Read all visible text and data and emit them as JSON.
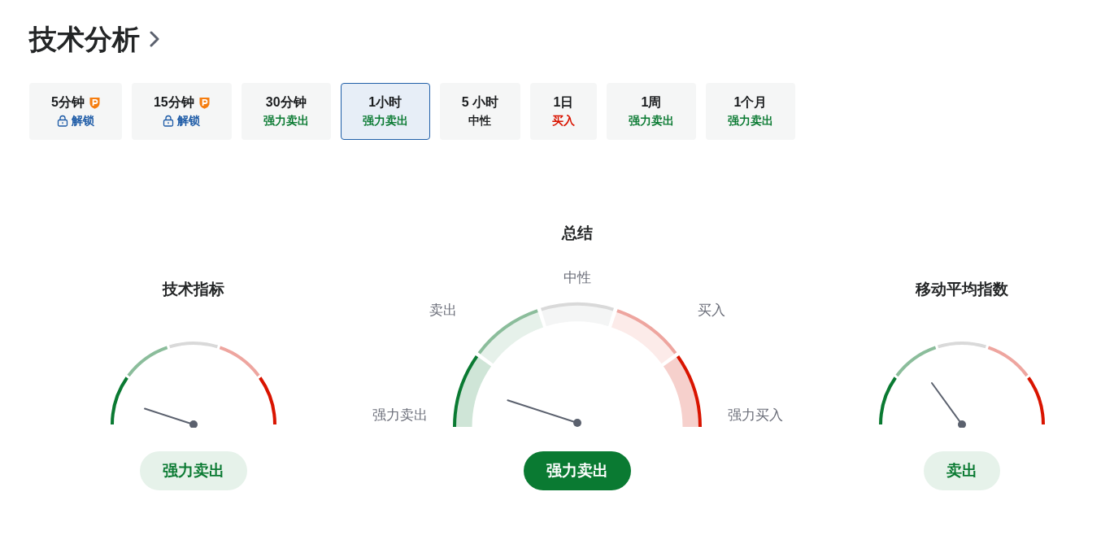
{
  "header": {
    "title": "技术分析"
  },
  "timeframes": [
    {
      "label": "5分钟",
      "status": "解锁",
      "kind": "locked",
      "selected": false
    },
    {
      "label": "15分钟",
      "status": "解锁",
      "kind": "locked",
      "selected": false
    },
    {
      "label": "30分钟",
      "status": "强力卖出",
      "kind": "sell",
      "selected": false
    },
    {
      "label": "1小时",
      "status": "强力卖出",
      "kind": "sell",
      "selected": true
    },
    {
      "label": "5 小时",
      "status": "中性",
      "kind": "neutral",
      "selected": false
    },
    {
      "label": "1日",
      "status": "买入",
      "kind": "buy",
      "selected": false
    },
    {
      "label": "1周",
      "status": "强力卖出",
      "kind": "sell",
      "selected": false
    },
    {
      "label": "1个月",
      "status": "强力卖出",
      "kind": "sell",
      "selected": false
    }
  ],
  "gauges": [
    {
      "kind": "compact",
      "title": "技术指标",
      "zones": [
        {
          "selected": true
        },
        {
          "selected": false
        },
        {
          "selected": false
        },
        {
          "selected": false
        },
        {
          "selected": false
        }
      ],
      "verdict": "强力卖出"
    },
    {
      "kind": "summary",
      "title": "总结",
      "zones": [
        {
          "label": "强力卖出",
          "selected": true
        },
        {
          "label": "卖出",
          "selected": false
        },
        {
          "label": "中性",
          "selected": false
        },
        {
          "label": "买入",
          "selected": false
        },
        {
          "label": "强力买入",
          "selected": false
        }
      ],
      "verdict": "强力卖出"
    },
    {
      "kind": "compact",
      "title": "移动平均指数",
      "zones": [
        {
          "selected": false
        },
        {
          "selected": true
        },
        {
          "selected": false
        },
        {
          "selected": false
        },
        {
          "selected": false
        }
      ],
      "verdict": "卖出"
    }
  ]
}
